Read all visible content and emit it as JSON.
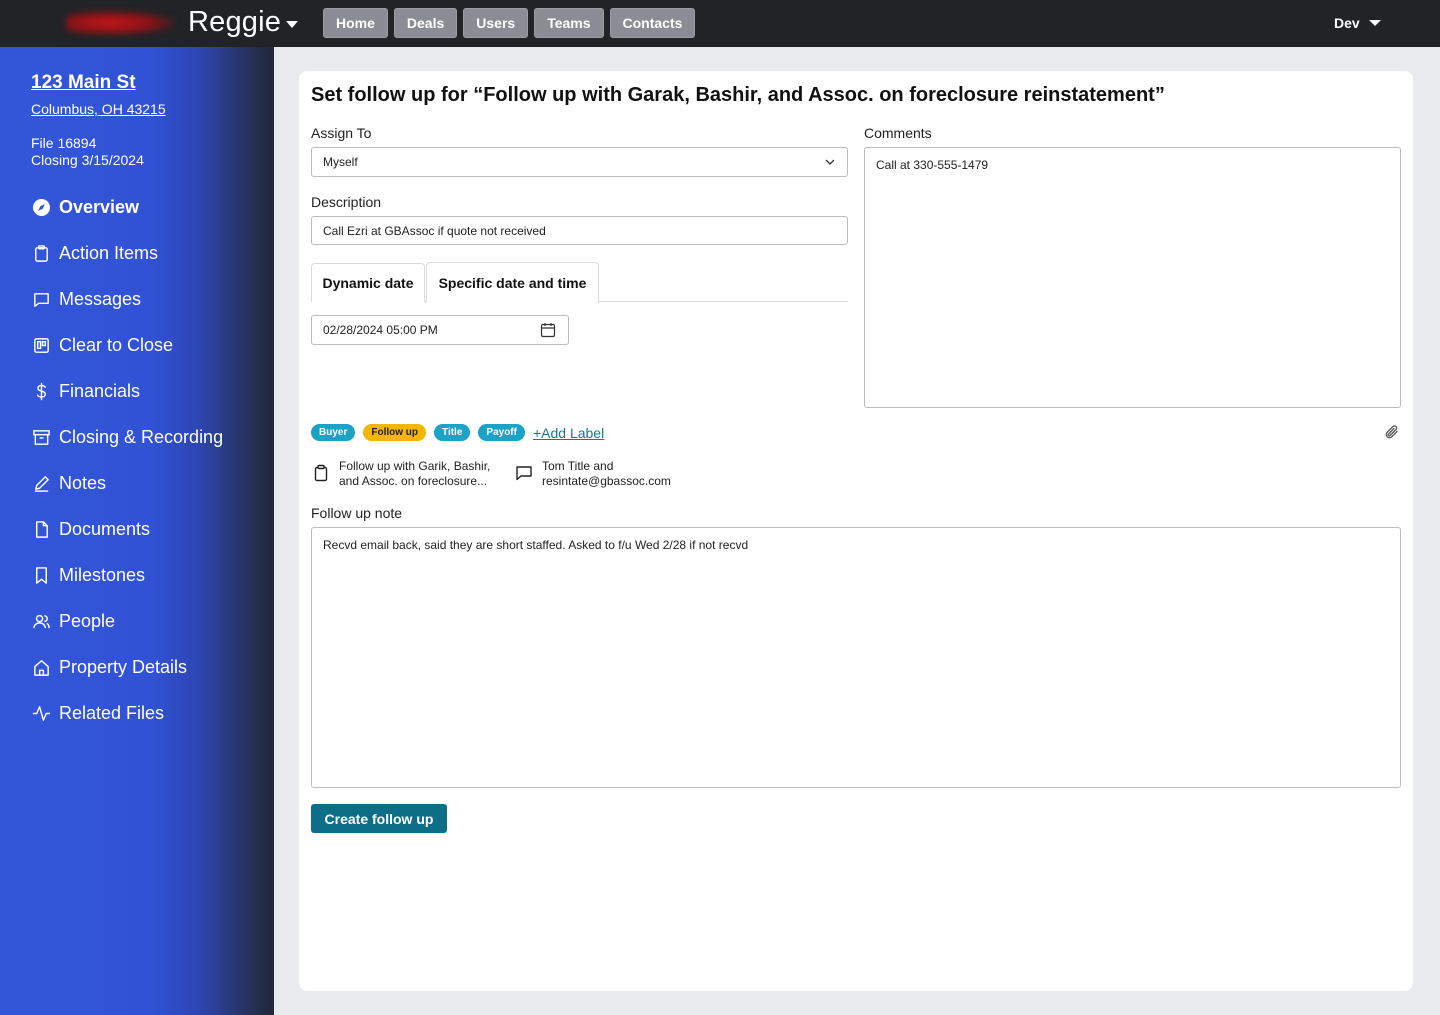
{
  "header": {
    "brand": "Reggie",
    "nav": [
      "Home",
      "Deals",
      "Users",
      "Teams",
      "Contacts"
    ],
    "user": "Dev"
  },
  "sidebar": {
    "address_line1": "123 Main St",
    "address_line2": "Columbus, OH 43215",
    "file": "File 16894",
    "closing": "Closing 3/15/2024",
    "items": [
      {
        "label": "Overview",
        "icon": "compass-icon"
      },
      {
        "label": "Action Items",
        "icon": "clipboard-icon"
      },
      {
        "label": "Messages",
        "icon": "message-icon"
      },
      {
        "label": "Clear to Close",
        "icon": "kanban-icon"
      },
      {
        "label": "Financials",
        "icon": "dollar-icon"
      },
      {
        "label": "Closing & Recording",
        "icon": "archive-icon"
      },
      {
        "label": "Notes",
        "icon": "pencil-icon"
      },
      {
        "label": "Documents",
        "icon": "document-icon"
      },
      {
        "label": "Milestones",
        "icon": "bookmark-icon"
      },
      {
        "label": "People",
        "icon": "people-icon"
      },
      {
        "label": "Property Details",
        "icon": "home-icon"
      },
      {
        "label": "Related Files",
        "icon": "activity-icon"
      }
    ]
  },
  "form": {
    "title": "Set follow up for “Follow up with Garak, Bashir, and Assoc. on foreclosure reinstatement”",
    "assign_label": "Assign To",
    "assign_value": "Myself",
    "description_label": "Description",
    "description_value": "Call Ezri at GBAssoc if quote not received",
    "tab_dynamic": "Dynamic date",
    "tab_specific": "Specific date and time",
    "datetime_value": "02/28/2024 05:00 PM",
    "comments_label": "Comments",
    "comments_value": "Call at 330-555-1479",
    "labels": [
      {
        "text": "Buyer",
        "color": "#1aa3c6"
      },
      {
        "text": "Follow up",
        "color": "#f2b705"
      },
      {
        "text": "Title",
        "color": "#1aa3c6"
      },
      {
        "text": "Payoff",
        "color": "#1aa3c6"
      }
    ],
    "add_label": "+Add Label",
    "related_action_line1": "Follow up with Garik, Bashir,",
    "related_action_line2": "and Assoc. on foreclosure...",
    "related_message_line1": "Tom Title and",
    "related_message_line2": "resintate@gbassoc.com",
    "note_label": "Follow up note",
    "note_value": "Recvd email back, said they are short staffed. Asked to f/u Wed 2/28 if not recvd",
    "submit_label": "Create follow up"
  }
}
